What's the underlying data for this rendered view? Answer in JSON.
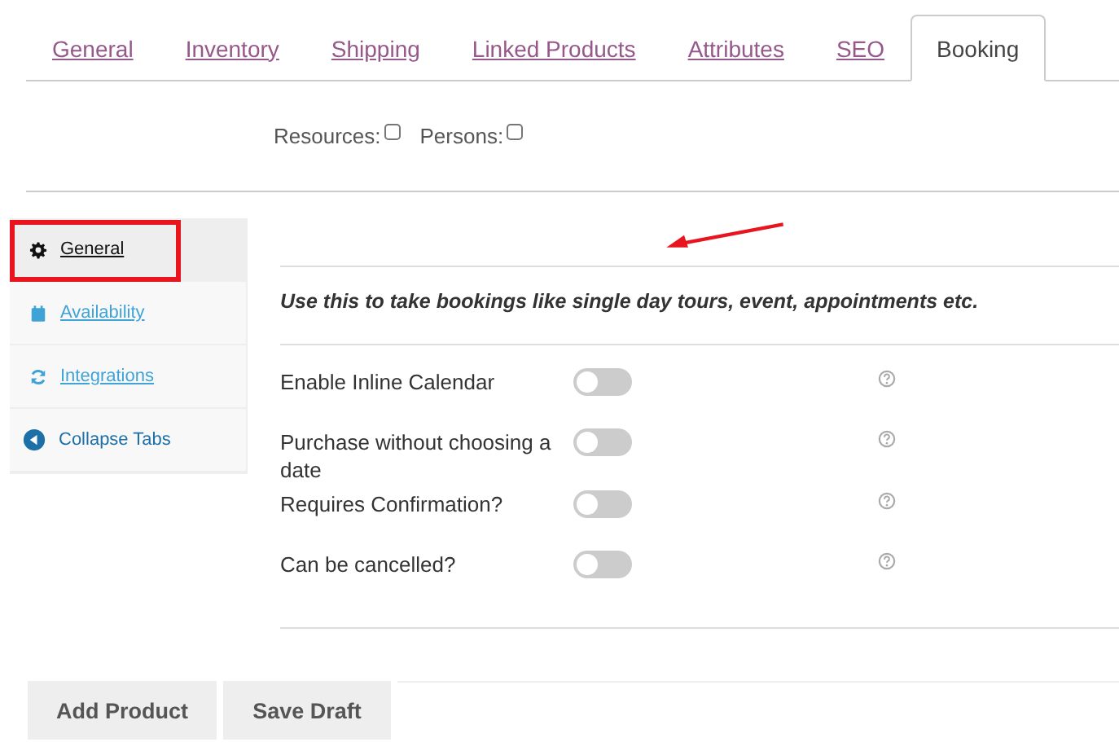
{
  "tabs": [
    {
      "label": "General",
      "selected": false
    },
    {
      "label": "Inventory",
      "selected": false
    },
    {
      "label": "Shipping",
      "selected": false
    },
    {
      "label": "Linked Products",
      "selected": false
    },
    {
      "label": "Attributes",
      "selected": false
    },
    {
      "label": "SEO",
      "selected": false
    },
    {
      "label": "Booking",
      "selected": true
    }
  ],
  "options": [
    {
      "label": "Resources:",
      "checked": false
    },
    {
      "label": "Persons:",
      "checked": false
    }
  ],
  "sidebar": {
    "items": [
      {
        "label": "General",
        "kind": "gear",
        "selected": true,
        "highlighted": true
      },
      {
        "label": "Availability",
        "kind": "calendar",
        "selected": false,
        "highlighted": false
      },
      {
        "label": "Integrations",
        "kind": "sync",
        "selected": false,
        "highlighted": false
      },
      {
        "label": "Collapse Tabs",
        "kind": "collapse",
        "selected": false,
        "highlighted": false
      }
    ]
  },
  "description": "Use this to take bookings like single day tours, event, appointments etc.",
  "settings": [
    {
      "label": "Enable Inline Calendar",
      "on": false
    },
    {
      "label": "Purchase without choosing a date",
      "on": false
    },
    {
      "label": "Requires Confirmation?",
      "on": false
    },
    {
      "label": "Can be cancelled?",
      "on": false
    }
  ],
  "buttons": [
    "Add Product",
    "Save Draft"
  ]
}
